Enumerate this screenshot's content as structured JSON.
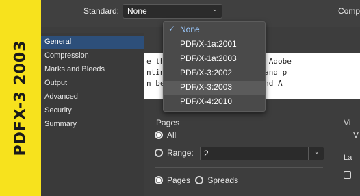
{
  "banner": {
    "text": "PDFX-3 2003"
  },
  "topbar": {
    "standard_label": "Standard:",
    "standard_value": "None",
    "compat_label": "Compa"
  },
  "sidebar": {
    "items": [
      {
        "label": "General",
        "selected": true
      },
      {
        "label": "Compression",
        "selected": false
      },
      {
        "label": "Marks and Bleeds",
        "selected": false
      },
      {
        "label": "Output",
        "selected": false
      },
      {
        "label": "Advanced",
        "selected": false
      },
      {
        "label": "Security",
        "selected": false
      },
      {
        "label": "Summary",
        "selected": false
      }
    ]
  },
  "description": {
    "lines": [
      "e these settings to create Adobe",
      "nting on desktop printers and p",
      "n be opened with Acrobat and A"
    ]
  },
  "pages": {
    "title": "Pages",
    "all_label": "All",
    "range_label": "Range:",
    "range_value": "2",
    "pages_label": "Pages",
    "spreads_label": "Spreads"
  },
  "right_panel": {
    "title": "Vi",
    "sub": "V",
    "lay_label": "La"
  },
  "dropdown": {
    "options": [
      {
        "label": "None",
        "checked": true
      },
      {
        "label": "PDF/X-1a:2001",
        "checked": false
      },
      {
        "label": "PDF/X-1a:2003",
        "checked": false
      },
      {
        "label": "PDF/X-3:2002",
        "checked": false
      },
      {
        "label": "PDF/X-3:2003",
        "checked": false
      },
      {
        "label": "PDF/X-4:2010",
        "checked": false
      }
    ],
    "check_glyph": "✓"
  },
  "colors": {
    "banner": "#f7e21d",
    "selected_item": "#2d4f7a",
    "checked_option": "#9ccaff"
  }
}
